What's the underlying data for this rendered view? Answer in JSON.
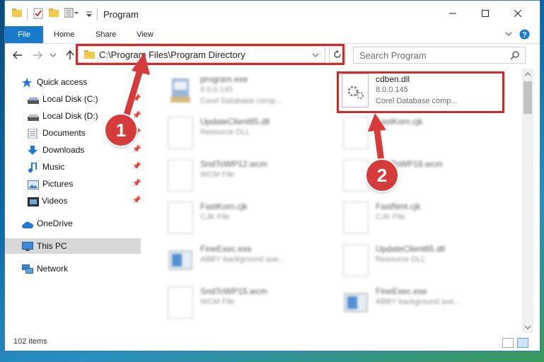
{
  "window": {
    "title": "Program",
    "colors": {
      "accent": "#1979ca",
      "highlight": "#d12a2a",
      "marker": "#d63b3b"
    }
  },
  "ribbon": {
    "tabs": [
      "File",
      "Home",
      "Share",
      "View"
    ]
  },
  "address": {
    "path": "C:\\Program Files\\Program Directory"
  },
  "search": {
    "placeholder": "Search Program"
  },
  "sidebar": {
    "quick_access": "Quick access",
    "items": [
      {
        "label": "Local Disk (C:)",
        "icon": "drive-icon"
      },
      {
        "label": "Local Disk (D:)",
        "icon": "drive-icon"
      },
      {
        "label": "Documents",
        "icon": "documents-icon"
      },
      {
        "label": "Downloads",
        "icon": "download-icon"
      },
      {
        "label": "Music",
        "icon": "music-icon"
      },
      {
        "label": "Pictures",
        "icon": "pictures-icon"
      },
      {
        "label": "Videos",
        "icon": "videos-icon"
      }
    ],
    "onedrive": "OneDrive",
    "this_pc": "This PC",
    "network": "Network"
  },
  "files": [
    {
      "name": "program.exe",
      "line2": "8.0.0.145",
      "line3": "Corel Database comp...",
      "icon": "exe-icon"
    },
    {
      "name": "cdben.dll",
      "line2": "8.0.0.145",
      "line3": "Corel Database comp...",
      "icon": "dll-icon"
    },
    {
      "name": "UpdateClient65.dll",
      "line2": "Resource DLL",
      "line3": "",
      "icon": "dll-icon"
    },
    {
      "name": "FastKorn.cjk",
      "line2": "",
      "line3": "",
      "icon": "file-icon"
    },
    {
      "name": "SndToWP12.wcm",
      "line2": "WCM File",
      "line3": "",
      "icon": "file-icon"
    },
    {
      "name": "SndToWP16.wcm",
      "line2": "",
      "line3": "",
      "icon": "file-icon"
    },
    {
      "name": "FastKorn.cjk",
      "line2": "CJK File",
      "line3": "",
      "icon": "file-icon"
    },
    {
      "name": "FastNmt.cjk",
      "line2": "CJK File",
      "line3": "",
      "icon": "file-icon"
    },
    {
      "name": "FineExec.exe",
      "line2": "ABBY background ave...",
      "line3": "",
      "icon": "app-icon"
    },
    {
      "name": "UpdateClient65.dll",
      "line2": "Resource DLL",
      "line3": "",
      "icon": "dll-icon"
    },
    {
      "name": "SndToWP15.wcm",
      "line2": "WCM File",
      "line3": "",
      "icon": "file-icon"
    },
    {
      "name": "FineExec.exe",
      "line2": "ABBY background ave...",
      "line3": "",
      "icon": "app-icon"
    }
  ],
  "status": {
    "count": "102 items"
  },
  "markers": [
    "1",
    "2"
  ]
}
